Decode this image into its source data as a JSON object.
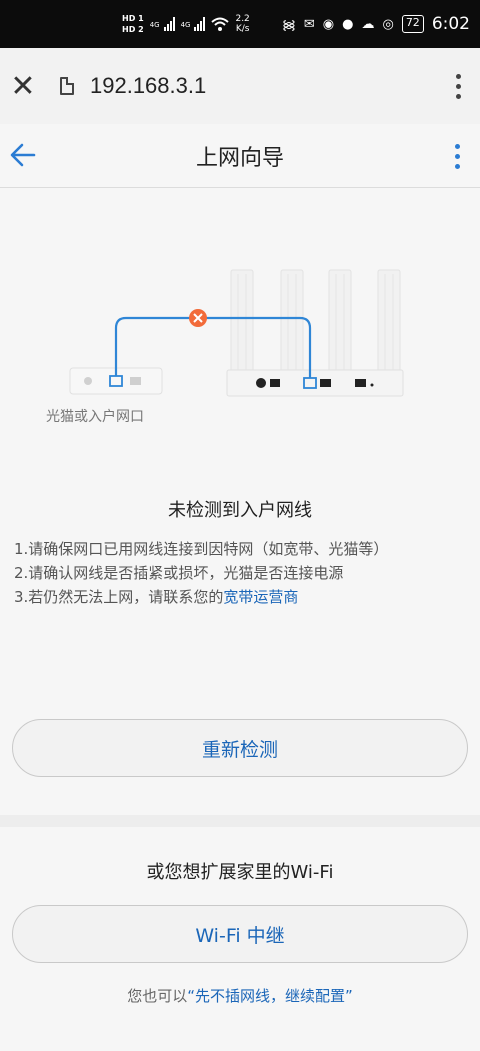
{
  "status_bar": {
    "hd1": "HD 1",
    "hd2": "HD 2",
    "net1": "4G",
    "net2": "4G",
    "speed_value": "2.2",
    "speed_unit": "K/s",
    "battery": "72",
    "time": "6:02"
  },
  "browser": {
    "url": "192.168.3.1"
  },
  "header": {
    "title": "上网向导"
  },
  "illustration": {
    "modem_label": "光猫或入户网口",
    "error_color": "#f26b3a",
    "cable_color": "#2f86d6"
  },
  "message": {
    "title": "未检测到入户网线",
    "tip1": "1.请确保网口已用网线连接到因特网（如宽带、光猫等）",
    "tip2": "2.请确认网线是否插紧或损坏，光猫是否连接电源",
    "tip3_prefix": "3.若仍然无法上网，请联系您的",
    "tip3_link": "宽带运营商"
  },
  "buttons": {
    "retry": "重新检测",
    "relay": "Wi-Fi 中继"
  },
  "extend": {
    "title": "或您想扩展家里的Wi-Fi",
    "note_prefix": "您也可以",
    "note_link": "“先不插网线，继续配置”"
  }
}
